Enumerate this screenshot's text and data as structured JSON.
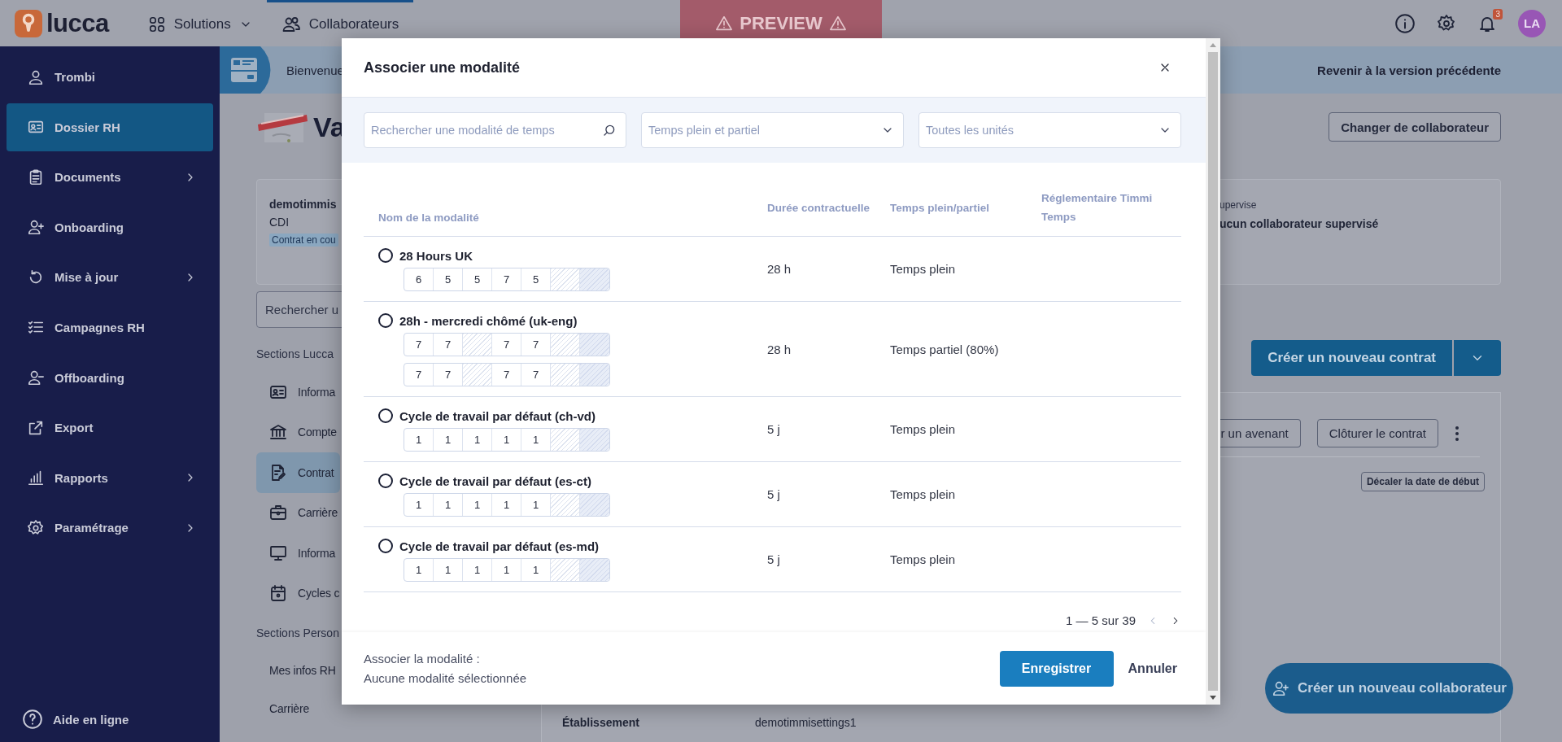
{
  "topbar": {
    "logo": "lucca",
    "nav": [
      {
        "label": "Solutions",
        "kind": "dropdown",
        "selected": false
      },
      {
        "label": "Collaborateurs",
        "kind": "link",
        "selected": true
      }
    ],
    "preview": "PREVIEW",
    "notifications": "3",
    "avatar": "LA"
  },
  "sidebar": {
    "items": [
      {
        "label": "Trombi",
        "selected": false,
        "has_submenu": false
      },
      {
        "label": "Dossier RH",
        "selected": true,
        "has_submenu": false
      },
      {
        "label": "Documents",
        "selected": false,
        "has_submenu": true
      },
      {
        "label": "Onboarding",
        "selected": false,
        "has_submenu": false
      },
      {
        "label": "Mise à jour",
        "selected": false,
        "has_submenu": true
      },
      {
        "label": "Campagnes RH",
        "selected": false,
        "has_submenu": false
      },
      {
        "label": "Offboarding",
        "selected": false,
        "has_submenu": false
      },
      {
        "label": "Export",
        "selected": false,
        "has_submenu": false
      },
      {
        "label": "Rapports",
        "selected": false,
        "has_submenu": true
      },
      {
        "label": "Paramétrage",
        "selected": false,
        "has_submenu": true
      }
    ],
    "help": "Aide en ligne"
  },
  "banner": {
    "text": "Bienvenue",
    "link": "Revenir à la version précédente"
  },
  "profile": {
    "name": "Va",
    "change_button": "Changer de collaborateur"
  },
  "summary": {
    "company": "demotimmis",
    "contract": "CDI",
    "status": "Contrat en cou",
    "manager_label": "upervise",
    "manager_value": "ucun collaborateur supervisé"
  },
  "sections": {
    "search": {
      "placeholder": "Rechercher u"
    },
    "groups": [
      {
        "title": "Sections Lucca",
        "items": [
          {
            "label": "Informa",
            "selected": false
          },
          {
            "label": "Compte",
            "selected": false
          },
          {
            "label": "Contrat",
            "selected": true
          },
          {
            "label": "Carrière",
            "selected": false
          },
          {
            "label": "Informa",
            "selected": false
          },
          {
            "label": "Cycles c",
            "selected": false
          }
        ]
      },
      {
        "title": "Sections Person",
        "items": [
          {
            "label": "Mes infos RH",
            "selected": false
          },
          {
            "label": "Carrière",
            "selected": false
          }
        ]
      }
    ]
  },
  "contracts": {
    "create_button": "Créer un nouveau contrat",
    "actions": [
      "r un avenant",
      "Clôturer le contrat"
    ],
    "shift_button": "Décaler la date de début",
    "fields": [
      {
        "label": "Établissement",
        "value": "demotimmisettings1"
      }
    ]
  },
  "fab": "Créer un nouveau collaborateur",
  "modal": {
    "title": "Associer une modalité",
    "search": {
      "placeholder": "Rechercher une modalité de temps"
    },
    "filters": [
      {
        "placeholder": "Temps plein et partiel"
      },
      {
        "placeholder": "Toutes les unités"
      }
    ],
    "columns": [
      "Nom de la modalité",
      "Durée contractuelle",
      "Temps plein/partiel",
      "Réglementaire Timmi Temps"
    ],
    "rows": [
      {
        "name": "28 Hours UK",
        "selected": false,
        "duration": "28 h",
        "time_type": "Temps plein",
        "weeks": [
          [
            {
              "kind": "work",
              "value": "6"
            },
            {
              "kind": "work",
              "value": "5"
            },
            {
              "kind": "work",
              "value": "5"
            },
            {
              "kind": "work",
              "value": "7"
            },
            {
              "kind": "work",
              "value": "5"
            },
            {
              "kind": "off"
            },
            {
              "kind": "rest"
            }
          ]
        ]
      },
      {
        "name": "28h - mercredi chômé (uk-eng)",
        "selected": false,
        "duration": "28 h",
        "time_type": "Temps partiel (80%)",
        "weeks": [
          [
            {
              "kind": "work",
              "value": "7"
            },
            {
              "kind": "work",
              "value": "7"
            },
            {
              "kind": "off"
            },
            {
              "kind": "work",
              "value": "7"
            },
            {
              "kind": "work",
              "value": "7"
            },
            {
              "kind": "off"
            },
            {
              "kind": "rest"
            }
          ],
          [
            {
              "kind": "work",
              "value": "7"
            },
            {
              "kind": "work",
              "value": "7"
            },
            {
              "kind": "off"
            },
            {
              "kind": "work",
              "value": "7"
            },
            {
              "kind": "work",
              "value": "7"
            },
            {
              "kind": "off"
            },
            {
              "kind": "rest"
            }
          ]
        ]
      },
      {
        "name": "Cycle de travail par défaut (ch-vd)",
        "selected": false,
        "duration": "5 j",
        "time_type": "Temps plein",
        "weeks": [
          [
            {
              "kind": "work",
              "value": "1"
            },
            {
              "kind": "work",
              "value": "1"
            },
            {
              "kind": "work",
              "value": "1"
            },
            {
              "kind": "work",
              "value": "1"
            },
            {
              "kind": "work",
              "value": "1"
            },
            {
              "kind": "off"
            },
            {
              "kind": "rest"
            }
          ]
        ]
      },
      {
        "name": "Cycle de travail par défaut (es-ct)",
        "selected": false,
        "duration": "5 j",
        "time_type": "Temps plein",
        "weeks": [
          [
            {
              "kind": "work",
              "value": "1"
            },
            {
              "kind": "work",
              "value": "1"
            },
            {
              "kind": "work",
              "value": "1"
            },
            {
              "kind": "work",
              "value": "1"
            },
            {
              "kind": "work",
              "value": "1"
            },
            {
              "kind": "off"
            },
            {
              "kind": "rest"
            }
          ]
        ]
      },
      {
        "name": "Cycle de travail par défaut (es-md)",
        "selected": false,
        "duration": "5 j",
        "time_type": "Temps plein",
        "weeks": [
          [
            {
              "kind": "work",
              "value": "1"
            },
            {
              "kind": "work",
              "value": "1"
            },
            {
              "kind": "work",
              "value": "1"
            },
            {
              "kind": "work",
              "value": "1"
            },
            {
              "kind": "work",
              "value": "1"
            },
            {
              "kind": "off"
            },
            {
              "kind": "rest"
            }
          ]
        ]
      }
    ],
    "pagination": {
      "range": "1 — 5 sur 39",
      "prev_disabled": true,
      "next_disabled": false
    },
    "footer": {
      "label": "Associer la modalité :",
      "value": "Aucune modalité sélectionnée"
    },
    "save_button": "Enregistrer",
    "cancel_button": "Annuler"
  }
}
